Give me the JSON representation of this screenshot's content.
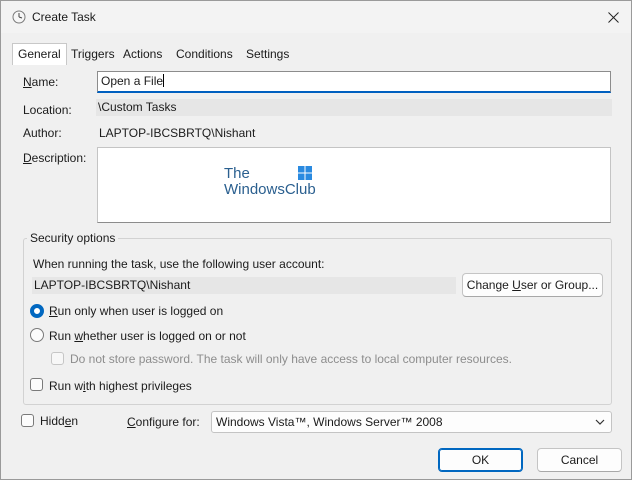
{
  "window": {
    "title": "Create Task",
    "icon": "clock-icon"
  },
  "tabs": [
    {
      "label": "General",
      "active": true
    },
    {
      "label": "Triggers",
      "active": false
    },
    {
      "label": "Actions",
      "active": false
    },
    {
      "label": "Conditions",
      "active": false
    },
    {
      "label": "Settings",
      "active": false
    }
  ],
  "general": {
    "name_label": "Name:",
    "name_value": "Open a File",
    "location_label": "Location:",
    "location_value": "\\Custom Tasks",
    "author_label": "Author:",
    "author_value": "LAPTOP-IBCSBRTQ\\Nishant",
    "description_label": "Description:",
    "description_value": "",
    "watermark": {
      "line1": "The",
      "line2": "WindowsClub"
    }
  },
  "security": {
    "title": "Security options",
    "account_prompt": "When running the task, use the following user account:",
    "account_value": "LAPTOP-IBCSBRTQ\\Nishant",
    "change_button": "Change User or Group...",
    "radio_logged_on": "Run only when user is logged on",
    "radio_whether": "Run whether user is logged on or not",
    "no_store_password": "Do not store password.  The task will only have access to local computer resources.",
    "highest_privileges": "Run with highest privileges",
    "selected_option": "Run only when user is logged on"
  },
  "footer": {
    "hidden_label": "Hidden",
    "configure_label": "Configure for:",
    "configure_value": "Windows Vista™, Windows Server™ 2008",
    "ok_button": "OK",
    "cancel_button": "Cancel"
  },
  "colors": {
    "accent": "#0067c0",
    "background": "#f0f0f0"
  }
}
